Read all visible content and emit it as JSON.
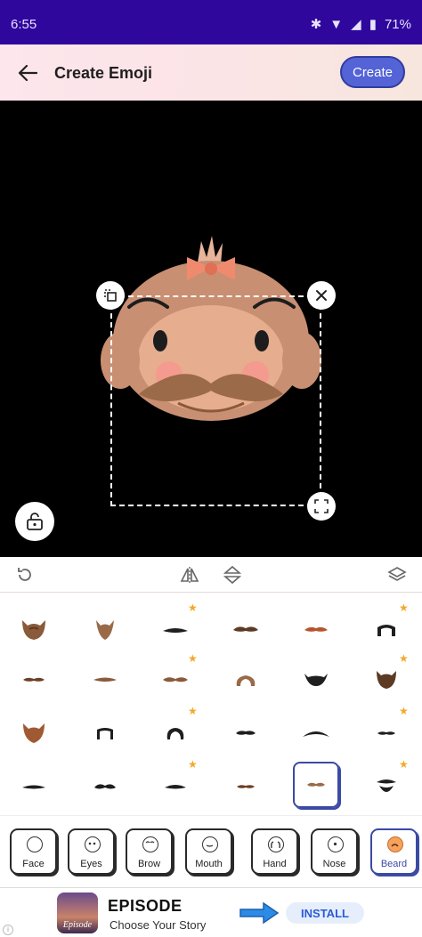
{
  "status_bar": {
    "time": "6:55",
    "battery": "71%"
  },
  "app_bar": {
    "title": "Create Emoji",
    "create_label": "Create"
  },
  "categories": [
    {
      "label": "Face"
    },
    {
      "label": "Eyes"
    },
    {
      "label": "Brow"
    },
    {
      "label": "Mouth"
    },
    {
      "label": "Hand"
    },
    {
      "label": "Nose"
    },
    {
      "label": "Beard"
    }
  ],
  "active_category": "Beard",
  "beard_grid": {
    "rows": 4,
    "columns": 6,
    "selected_item": "row-4-col-5",
    "starred_items": [
      "row-1-col-3",
      "row-1-col-6",
      "row-2-col-3",
      "row-2-col-6",
      "row-3-col-3",
      "row-3-col-6",
      "row-4-col-3",
      "row-4-col-6"
    ]
  },
  "ad": {
    "title": "EPISODE",
    "subtitle": "Choose Your Story",
    "install_label": "INSTALL",
    "logo_text": "Episode"
  },
  "colors": {
    "status_bar": "#2f079d",
    "accent": "#5463d6",
    "beard_brown": "#8a5a3a",
    "star": "#f2a92b",
    "canvas": "#000000"
  }
}
